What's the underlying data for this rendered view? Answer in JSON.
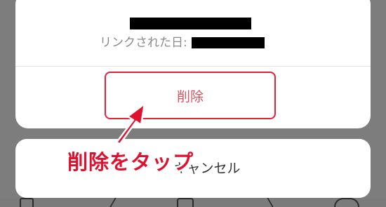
{
  "dialog": {
    "linked_label": "リンクされた日:",
    "delete_label": "削除"
  },
  "cancel_label": "キャンセル",
  "annotation": {
    "text": "削除をタップ"
  },
  "colors": {
    "highlight": "#e3223a",
    "delete_text": "#d35560",
    "overlay": "#7d7d7d"
  },
  "icons": [
    "home-icon",
    "chevron-icon",
    "square-icon",
    "chevron-icon",
    "circle-icon",
    "arrow-icon"
  ]
}
